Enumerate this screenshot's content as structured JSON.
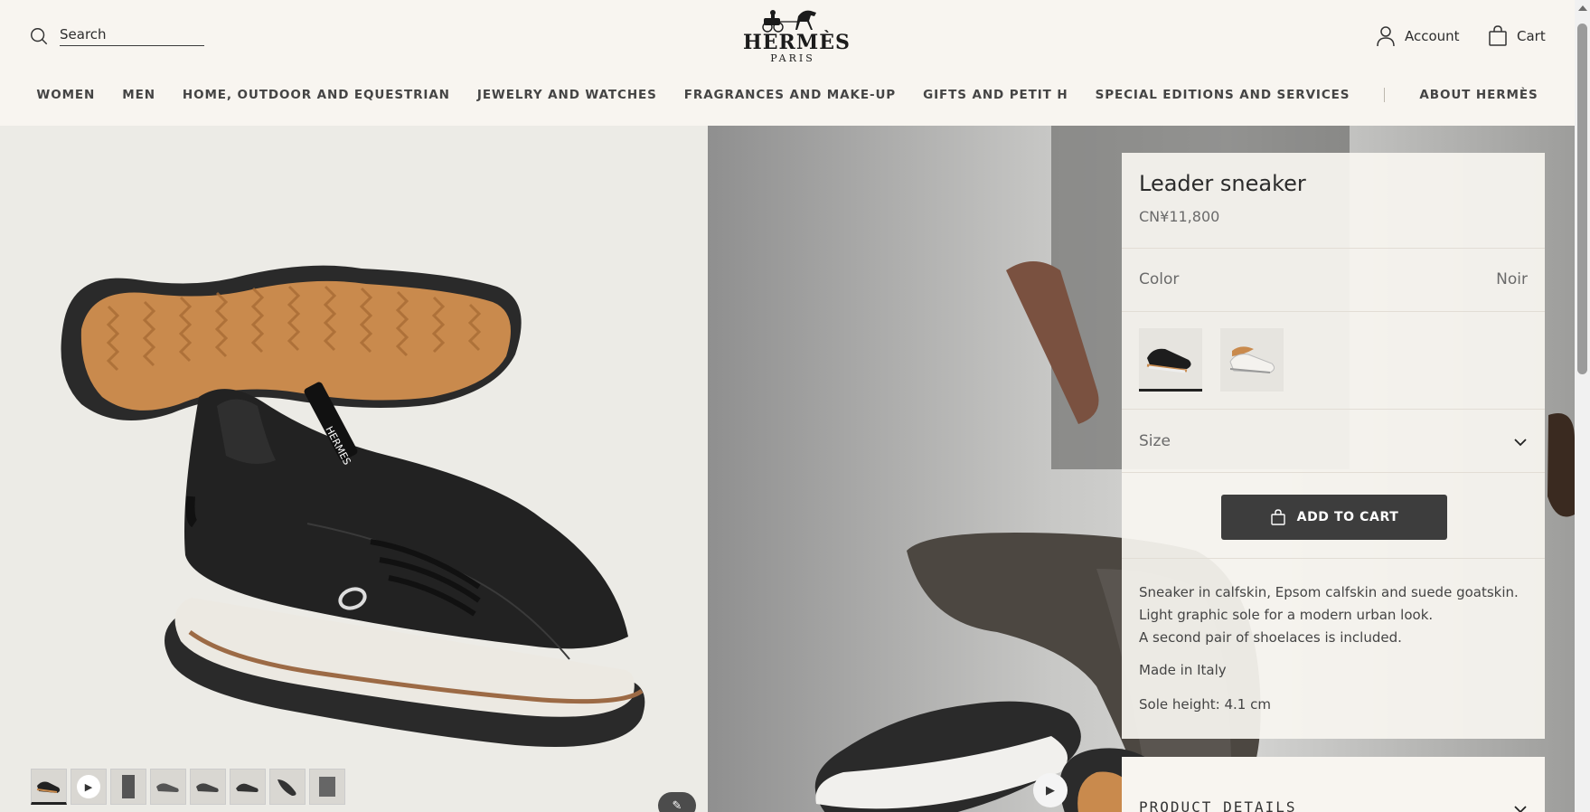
{
  "header": {
    "search_placeholder": "Search",
    "logo_name": "HERMÈS",
    "logo_city": "PARIS",
    "account_label": "Account",
    "cart_label": "Cart"
  },
  "nav": {
    "items": [
      "WOMEN",
      "MEN",
      "HOME, OUTDOOR AND EQUESTRIAN",
      "JEWELRY AND WATCHES",
      "FRAGRANCES AND MAKE-UP",
      "GIFTS AND PETIT H",
      "SPECIAL EDITIONS AND SERVICES"
    ],
    "about": "ABOUT HERMÈS"
  },
  "gallery": {
    "thumb_count": 8,
    "active_thumb": 1
  },
  "product": {
    "title": "Leader sneaker",
    "price": "CN¥11,800",
    "color_label": "Color",
    "color_value": "Noir",
    "size_label": "Size",
    "add_to_cart": "ADD TO CART",
    "description": [
      "Sneaker in calfskin, Epsom calfskin and suede goatskin.",
      "Light graphic sole for a modern urban look.",
      "A second pair of shoelaces is included."
    ],
    "made_in": "Made in Italy",
    "sole_height": "Sole height: 4.1 cm",
    "details_label": "PRODUCT DETAILS"
  },
  "colors": {
    "background": "#f8f5f0",
    "button": "#3d3d3d",
    "sole_tan": "#c98a4d"
  }
}
